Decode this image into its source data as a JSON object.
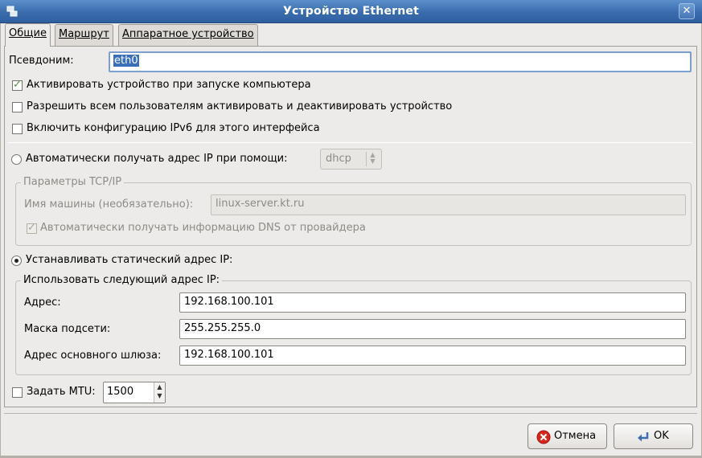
{
  "window": {
    "title": "Устройство Ethernet",
    "close_glyph": "✕"
  },
  "tabs": [
    {
      "label": "Общие",
      "active": true
    },
    {
      "label": "Маршрут",
      "active": false
    },
    {
      "label": "Аппаратное устройство",
      "active": false
    }
  ],
  "nickname": {
    "label": "Псевдоним:",
    "value": "eth0"
  },
  "options": {
    "activate_on_boot": {
      "label": "Активировать устройство при запуске компьютера",
      "checked": true
    },
    "allow_users": {
      "label": "Разрешить всем пользователям активировать и деактивировать устройство",
      "checked": false
    },
    "ipv6": {
      "label": "Включить конфигурацию IPv6 для этого интерфейса",
      "checked": false
    }
  },
  "auto_ip": {
    "label": "Автоматически получать адрес IP при помощи:",
    "selected": false,
    "method": "dhcp",
    "group_title": "Параметры TCP/IP",
    "hostname_label": "Имя машины (необязательно):",
    "hostname_value": "linux-server.kt.ru",
    "dns_label": "Автоматически получать информацию DNS от провайдера",
    "dns_checked": true
  },
  "static_ip": {
    "label": "Устанавливать статический адрес IP:",
    "selected": true,
    "group_title": "Использовать следующий адрес IP:",
    "address_label": "Адрес:",
    "address_value": "192.168.100.101",
    "netmask_label": "Маска подсети:",
    "netmask_value": "255.255.255.0",
    "gateway_label": "Адрес основного шлюза:",
    "gateway_value": "192.168.100.101"
  },
  "mtu": {
    "label": "Задать MTU:",
    "checked": false,
    "value": "1500"
  },
  "buttons": {
    "cancel": "Отмена",
    "ok": "OK"
  },
  "colors": {
    "titlebar": "#3a6cad",
    "selection": "#3a6fbb",
    "cancel_icon": "#d8261c",
    "ok_icon": "#3d6fb0"
  }
}
